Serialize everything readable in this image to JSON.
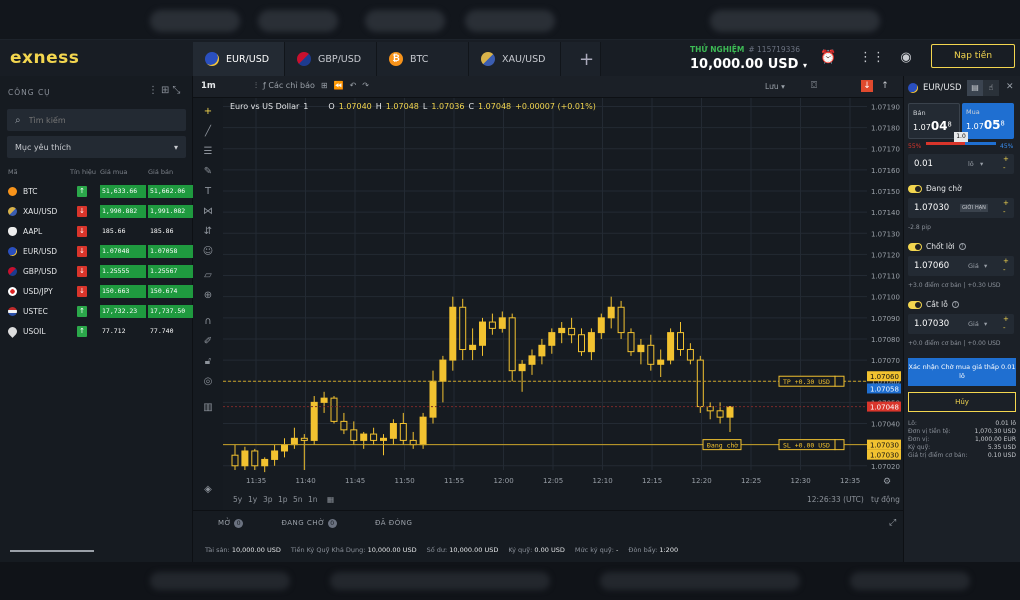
{
  "brand": {
    "logo": "exness"
  },
  "tabs": [
    {
      "label": "EUR/USD",
      "flag": "eu",
      "active": true
    },
    {
      "label": "GBP/USD",
      "flag": "gb",
      "active": false
    },
    {
      "label": "BTC",
      "flag": "btc",
      "active": false
    },
    {
      "label": "XAU/USD",
      "flag": "xau",
      "active": false
    }
  ],
  "account": {
    "mode": "THỬ NGHIỆM",
    "number": "# 115719336",
    "balance": "10,000.00 USD"
  },
  "header": {
    "deposit_label": "Nạp tiền"
  },
  "left": {
    "title": "CÔNG CỤ",
    "search_placeholder": "Tìm kiếm",
    "dropdown_value": "Mục yêu thích",
    "columns": {
      "symbol": "Mã",
      "signal": "Tín hiệu",
      "bid": "Giá mua",
      "ask": "Giá bán"
    },
    "rows": [
      {
        "symbol": "BTC",
        "icon": "btc",
        "signal": "up",
        "bid": "51,633.66",
        "ask": "51,662.06",
        "bg": "g"
      },
      {
        "symbol": "XAU/USD",
        "icon": "xau",
        "signal": "dn",
        "bid": "1,990.882",
        "ask": "1,991.082",
        "bg": "g"
      },
      {
        "symbol": "AAPL",
        "icon": "apple",
        "signal": "dn",
        "bid": "185.66",
        "ask": "185.86",
        "bg": ""
      },
      {
        "symbol": "EUR/USD",
        "icon": "eu",
        "signal": "dn",
        "bid": "1.07048",
        "ask": "1.07058",
        "bg": "g"
      },
      {
        "symbol": "GBP/USD",
        "icon": "gb",
        "signal": "dn",
        "bid": "1.25555",
        "ask": "1.25567",
        "bg": "g"
      },
      {
        "symbol": "USD/JPY",
        "icon": "jp",
        "signal": "dn",
        "bid": "150.663",
        "ask": "150.674",
        "bg": "g"
      },
      {
        "symbol": "USTEC",
        "icon": "us",
        "signal": "up",
        "bid": "17,732.23",
        "ask": "17,737.50",
        "bg": "g"
      },
      {
        "symbol": "USOIL",
        "icon": "oil",
        "signal": "up",
        "bid": "77.712",
        "ask": "77.740",
        "bg": ""
      }
    ]
  },
  "toolbar": {
    "timeframe": "1m",
    "indicators_label": "Các chỉ báo",
    "save_label": "Lưu"
  },
  "chart_data": {
    "type": "candlestick",
    "title": "Euro vs US Dollar",
    "interval": "1",
    "ohlc_label": {
      "o": "1.07040",
      "h": "1.07048",
      "l": "1.07036",
      "c": "1.07048",
      "chg": "+0.00007 (+0.01%)"
    },
    "ylim": [
      1.07018,
      1.07194
    ],
    "y_ticks": [
      "1.07190",
      "1.07180",
      "1.07170",
      "1.07160",
      "1.07150",
      "1.07140",
      "1.07130",
      "1.07120",
      "1.07110",
      "1.07100",
      "1.07090",
      "1.07080",
      "1.07070",
      "1.07060",
      "1.07050",
      "1.07040",
      "1.07030",
      "1.07020"
    ],
    "x_ticks": [
      "11:35",
      "11:40",
      "11:45",
      "11:50",
      "11:55",
      "12:00",
      "12:05",
      "12:10",
      "12:15",
      "12:20",
      "12:25",
      "12:30",
      "12:35"
    ],
    "candles": [
      [
        1.07025,
        1.0703,
        1.07018,
        1.0702
      ],
      [
        1.0702,
        1.07029,
        1.07018,
        1.07027
      ],
      [
        1.07027,
        1.07028,
        1.07018,
        1.0702
      ],
      [
        1.0702,
        1.07024,
        1.07017,
        1.07023
      ],
      [
        1.07023,
        1.0703,
        1.0702,
        1.07027
      ],
      [
        1.07027,
        1.07033,
        1.07024,
        1.0703
      ],
      [
        1.0703,
        1.07038,
        1.07028,
        1.07033
      ],
      [
        1.07033,
        1.07035,
        1.07018,
        1.07032
      ],
      [
        1.07032,
        1.07053,
        1.0703,
        1.0705
      ],
      [
        1.0705,
        1.07055,
        1.07045,
        1.07052
      ],
      [
        1.07052,
        1.07053,
        1.0704,
        1.07041
      ],
      [
        1.07041,
        1.07045,
        1.07035,
        1.07037
      ],
      [
        1.07037,
        1.07041,
        1.0703,
        1.07032
      ],
      [
        1.07032,
        1.07036,
        1.07028,
        1.07035
      ],
      [
        1.07035,
        1.07038,
        1.0703,
        1.07032
      ],
      [
        1.07032,
        1.07035,
        1.07025,
        1.07033
      ],
      [
        1.07033,
        1.07042,
        1.0703,
        1.0704
      ],
      [
        1.0704,
        1.07045,
        1.0703,
        1.07032
      ],
      [
        1.07032,
        1.07036,
        1.07028,
        1.0703
      ],
      [
        1.0703,
        1.07045,
        1.07028,
        1.07043
      ],
      [
        1.07043,
        1.07065,
        1.0704,
        1.0706
      ],
      [
        1.0706,
        1.07072,
        1.0705,
        1.0707
      ],
      [
        1.0707,
        1.071,
        1.07065,
        1.07095
      ],
      [
        1.07095,
        1.07099,
        1.0707,
        1.07075
      ],
      [
        1.07075,
        1.07085,
        1.0707,
        1.07077
      ],
      [
        1.07077,
        1.0709,
        1.07072,
        1.07088
      ],
      [
        1.07088,
        1.07092,
        1.07082,
        1.07085
      ],
      [
        1.07085,
        1.07093,
        1.07083,
        1.0709
      ],
      [
        1.0709,
        1.07092,
        1.0706,
        1.07065
      ],
      [
        1.07065,
        1.0707,
        1.07055,
        1.07068
      ],
      [
        1.07068,
        1.07075,
        1.07063,
        1.07072
      ],
      [
        1.07072,
        1.0708,
        1.07068,
        1.07077
      ],
      [
        1.07077,
        1.07085,
        1.07073,
        1.07083
      ],
      [
        1.07083,
        1.07088,
        1.07078,
        1.07085
      ],
      [
        1.07085,
        1.0709,
        1.07078,
        1.07082
      ],
      [
        1.07082,
        1.07085,
        1.07072,
        1.07074
      ],
      [
        1.07074,
        1.07085,
        1.0707,
        1.07083
      ],
      [
        1.07083,
        1.07092,
        1.0708,
        1.0709
      ],
      [
        1.0709,
        1.071,
        1.07085,
        1.07095
      ],
      [
        1.07095,
        1.07098,
        1.0708,
        1.07083
      ],
      [
        1.07083,
        1.07085,
        1.07072,
        1.07074
      ],
      [
        1.07074,
        1.0708,
        1.07068,
        1.07077
      ],
      [
        1.07077,
        1.07082,
        1.07065,
        1.07068
      ],
      [
        1.07068,
        1.07075,
        1.07062,
        1.0707
      ],
      [
        1.0707,
        1.07085,
        1.07068,
        1.07083
      ],
      [
        1.07083,
        1.07088,
        1.07072,
        1.07075
      ],
      [
        1.07075,
        1.07078,
        1.07068,
        1.0707
      ],
      [
        1.0707,
        1.07072,
        1.07045,
        1.07048
      ],
      [
        1.07048,
        1.0705,
        1.07042,
        1.07046
      ],
      [
        1.07046,
        1.0705,
        1.0704,
        1.07043
      ],
      [
        1.07043,
        1.07048,
        1.07036,
        1.07048
      ]
    ],
    "lines": {
      "tp": {
        "price": 1.0706,
        "label": "TP +0.30 USD",
        "axis": "1.07060"
      },
      "ask": {
        "price": 1.07058,
        "axis": "1.07058"
      },
      "bid": {
        "price": 1.07048,
        "axis": "1.07048"
      },
      "pending": {
        "price": 1.0703,
        "label": "Đang chờ",
        "sl_label": "SL +0.00 USD",
        "axis1": "1.07030",
        "axis2": "1.07030"
      }
    }
  },
  "periods": {
    "items": [
      "5y",
      "1y",
      "3p",
      "1p",
      "5n",
      "1n"
    ],
    "clock": "12:26:33 (UTC)",
    "auto": "tự động"
  },
  "bottom": {
    "tabs": [
      {
        "label": "MỞ",
        "count": "0"
      },
      {
        "label": "ĐANG CHỜ",
        "count": "0"
      },
      {
        "label": "ĐÃ ĐÓNG",
        "count": ""
      }
    ],
    "status": [
      {
        "k": "Tài sản:",
        "v": "10,000.00 USD"
      },
      {
        "k": "Tiền Ký Quỹ Khả Dụng:",
        "v": "10,000.00 USD"
      },
      {
        "k": "Số dư:",
        "v": "10,000.00 USD"
      },
      {
        "k": "Ký quỹ:",
        "v": "0.00 USD"
      },
      {
        "k": "Mức ký quỹ:",
        "v": "-"
      },
      {
        "k": "Đòn bẩy:",
        "v": "1:200"
      }
    ]
  },
  "order": {
    "symbol": "EUR/USD",
    "sell": {
      "label": "Bán",
      "prefix": "1.07",
      "big": "04",
      "sup": "8"
    },
    "buy": {
      "label": "Mua",
      "prefix": "1.07",
      "big": "05",
      "sup": "8"
    },
    "spread": "1.0",
    "sell_pct": "55%",
    "buy_pct": "45%",
    "volume": {
      "value": "0.01",
      "unit": "lô"
    },
    "pending": {
      "label": "Đang chờ",
      "value": "1.07030",
      "chip": "GIỚI HẠN",
      "note": "-2.8 pip"
    },
    "tp": {
      "label": "Chốt lời",
      "value": "1.07060",
      "unit": "Giá",
      "note": "+3.0 điểm cơ bản | +0.30 USD"
    },
    "sl": {
      "label": "Cắt lỗ",
      "value": "1.07030",
      "unit": "Giá",
      "note": "+0.0 điểm cơ bản | +0.00 USD"
    },
    "confirm": "Xác nhận Chờ mua giá thấp 0.01 lô",
    "cancel": "Hủy",
    "info": [
      {
        "k": "Lô:",
        "v": "0.01 lô"
      },
      {
        "k": "Đơn vị tiền tệ:",
        "v": "1,070.30 USD"
      },
      {
        "k": "Đơn vị:",
        "v": "1,000.00 EUR"
      },
      {
        "k": "Ký quỹ:",
        "v": "5.35 USD"
      },
      {
        "k": "Giá trị điểm cơ bản:",
        "v": "0.10 USD"
      }
    ]
  }
}
